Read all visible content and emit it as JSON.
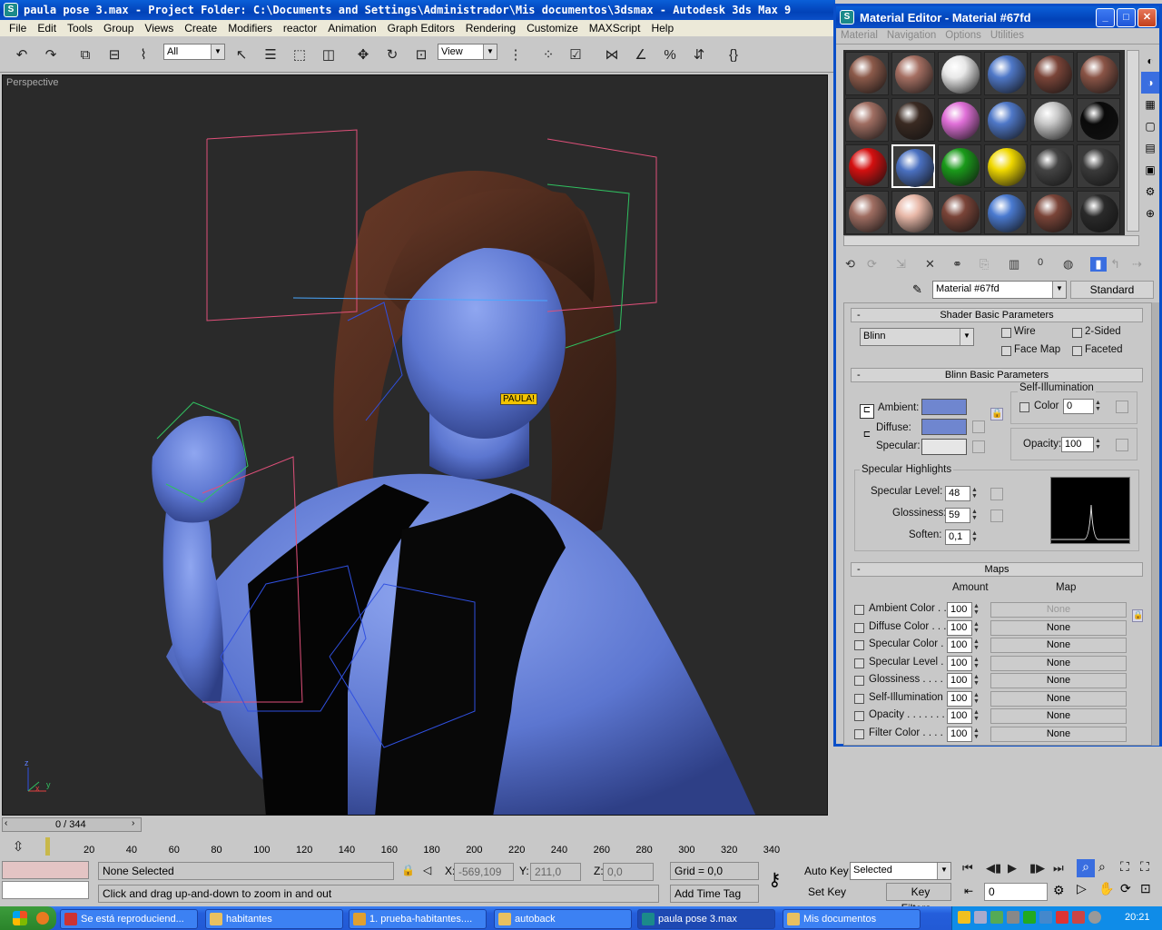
{
  "main_window": {
    "title": "paula pose 3.max  - Project Folder: C:\\Documents and Settings\\Administrador\\Mis documentos\\3dsmax   - Autodesk 3ds Max 9"
  },
  "menu": [
    "File",
    "Edit",
    "Tools",
    "Group",
    "Views",
    "Create",
    "Modifiers",
    "reactor",
    "Animation",
    "Graph Editors",
    "Rendering",
    "Customize",
    "MAXScript",
    "Help"
  ],
  "toolbar": {
    "selection_filter": "All",
    "ref_coord": "View"
  },
  "viewport": {
    "label": "Perspective",
    "tooltip": "PAULA!",
    "axis_x": "x",
    "axis_y": "y",
    "axis_z": "z"
  },
  "timeline": {
    "frame_display": "0 / 344",
    "ticks": [
      "20",
      "40",
      "60",
      "80",
      "100",
      "120",
      "140",
      "160",
      "180",
      "200",
      "220",
      "240",
      "260",
      "280",
      "300",
      "320",
      "340"
    ]
  },
  "status": {
    "selection": "None Selected",
    "prompt": "Click and drag up-and-down to zoom in and out",
    "x_label": "X:",
    "x_value": "-569,109",
    "y_label": "Y:",
    "y_value": "211,0",
    "z_label": "Z:",
    "z_value": "0,0",
    "grid": "Grid = 0,0",
    "add_time_tag": "Add Time Tag",
    "auto_key": "Auto Key",
    "set_key": "Set Key",
    "key_mode": "Selected",
    "key_filters": "Key Filters...",
    "frame": "0"
  },
  "material_editor": {
    "title": "Material Editor - Material #67fd",
    "menu": [
      "Material",
      "Navigation",
      "Options",
      "Utilities"
    ],
    "material_name": "Material #67fd",
    "material_type": "Standard",
    "shader_rollout": "Shader Basic Parameters",
    "shader": "Blinn",
    "wire": "Wire",
    "two_sided": "2-Sided",
    "face_map": "Face Map",
    "faceted": "Faceted",
    "blinn_rollout": "Blinn Basic Parameters",
    "self_illum_title": "Self-Illumination",
    "ambient": "Ambient:",
    "diffuse": "Diffuse:",
    "specular": "Specular:",
    "color": "Color",
    "color_value": "0",
    "opacity_label": "Opacity:",
    "opacity_value": "100",
    "spec_highlights": "Specular Highlights",
    "spec_level_label": "Specular Level:",
    "spec_level": "48",
    "glossiness_label": "Glossiness:",
    "glossiness": "59",
    "soften_label": "Soften:",
    "soften": "0,1",
    "maps_rollout": "Maps",
    "amount_header": "Amount",
    "map_header": "Map",
    "maps": [
      {
        "name": "Ambient Color . . .",
        "amount": "100",
        "map": "None"
      },
      {
        "name": "Diffuse Color . . . .",
        "amount": "100",
        "map": "None"
      },
      {
        "name": "Specular Color . .",
        "amount": "100",
        "map": "None"
      },
      {
        "name": "Specular Level  .",
        "amount": "100",
        "map": "None"
      },
      {
        "name": "Glossiness  . . . . .",
        "amount": "100",
        "map": "None"
      },
      {
        "name": "Self-Illumination .",
        "amount": "100",
        "map": "None"
      },
      {
        "name": "Opacity . . . . . . . .",
        "amount": "100",
        "map": "None"
      },
      {
        "name": "Filter Color  . . . . .",
        "amount": "100",
        "map": "None"
      }
    ],
    "colors": {
      "ambient": "#6f86cf",
      "diffuse": "#6f86cf",
      "specular": "#e6e6e6"
    },
    "slots": [
      "#8c5a4a",
      "#a56f62",
      "#e8e8e8",
      "#4f78c8",
      "#7a4438",
      "#8a5446",
      "#a06e62",
      "#3a2a22",
      "#e070d8",
      "#4f78c8",
      "#c8c8c8",
      "#0a0a0a",
      "#d41010",
      "#4a70c0",
      "#1a9a1a",
      "#f0d800",
      "#444444",
      "#3a3a3a",
      "#a06e62",
      "#e8b8a8",
      "#7a4438",
      "#4a7ad0",
      "#7a4438",
      "#2a2a2a"
    ]
  },
  "taskbar": {
    "tasks": [
      "Se está reproduciend...",
      "habitantes",
      "1. prueba-habitantes....",
      "autoback",
      "paula pose 3.max",
      "Mis documentos"
    ],
    "clock": "20:21"
  }
}
